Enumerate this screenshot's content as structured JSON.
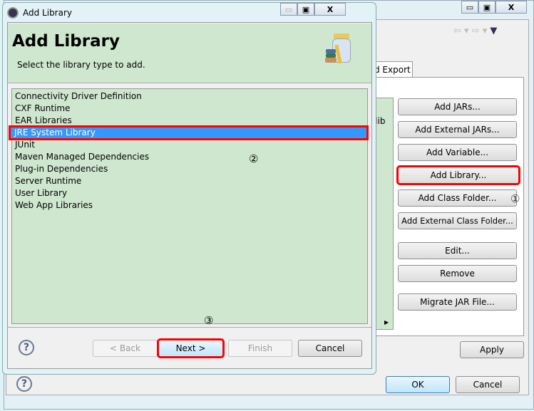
{
  "back_window": {
    "tab_label": "d Export",
    "path_fragment": "y/lib",
    "buttons": [
      "Add JARs...",
      "Add External JARs...",
      "Add Variable...",
      "Add Library...",
      "Add Class Folder...",
      "Add External Class Folder...",
      "Edit...",
      "Remove",
      "Migrate JAR File..."
    ],
    "apply_label": "Apply",
    "ok_label": "OK",
    "cancel_label": "Cancel"
  },
  "dialog": {
    "title": "Add Library",
    "header_title": "Add Library",
    "header_subtitle": "Select the library type to add.",
    "library_types": [
      "Connectivity Driver Definition",
      "CXF Runtime",
      "EAR Libraries",
      "JRE System Library",
      "JUnit",
      "Maven Managed Dependencies",
      "Plug-in Dependencies",
      "Server Runtime",
      "User Library",
      "Web App Libraries"
    ],
    "selected_index": 3,
    "back_label": "< Back",
    "next_label": "Next >",
    "finish_label": "Finish",
    "cancel_label": "Cancel"
  },
  "annotations": {
    "step1": "①",
    "step2": "②",
    "step3": "③"
  },
  "colors": {
    "highlight": "#ff0000",
    "selection": "#3399ff",
    "list_bg": "#cfe7cf"
  }
}
